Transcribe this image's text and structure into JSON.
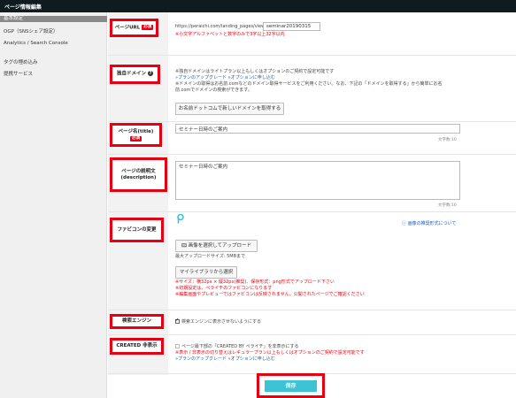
{
  "header": {
    "title": "ページ情報編集"
  },
  "sidebar": {
    "items": [
      {
        "label": "基本設定"
      },
      {
        "label": "OGP（SNSシェア設定）"
      },
      {
        "label": "Analytics / Search Console"
      },
      {
        "label": "タグの埋め込み"
      },
      {
        "label": "提携サービス"
      }
    ]
  },
  "rows": {
    "url": {
      "label": "ページURL",
      "required": "必須",
      "prefix": "https://peraichi.com/landing_pages/view/",
      "value": "seminar20190315",
      "note": "※小文字アルファベットと数字のみで3字以上32字以内"
    },
    "domain": {
      "label": "独自ドメイン",
      "help": "?",
      "note1": "※独自ドメインはライトプラン以上もしくはオプションのご契約で設定可能です",
      "link": "»プランのアップグレード »オプションに申し込む",
      "note2": "※ドメインの取得はお名前.comなどのドメイン取得サービスをご利用ください。なお、下記の「ドメインを取得する」から簡単にお名",
      "note3": "前.comでドメインの検索ができます。",
      "button": "お名前ドットコムで新しいドメインを取得する"
    },
    "title": {
      "label": "ページ名(title)",
      "required": "必須",
      "value": "セミナー日時のご案内",
      "counter": "文字数:10"
    },
    "description": {
      "label": "ページの説明文(description)",
      "value": "セミナー日時のご案内",
      "counter": "文字数:10"
    },
    "favicon": {
      "label": "ファビコンの変更",
      "help_link": "ⓘ 画像の推奨形式について",
      "upload_button": "画像を選択してアップロード",
      "max_size": "最大アップロードサイズ: 5MBまで",
      "library_button": "マイライブラリから選択",
      "note1": "※サイズ：横32px × 縦32px(推奨)、保存形式：png形式でアップロード下さい",
      "note2": "※初期設定は、ペライチのファビコンになります",
      "note3": "※編集画面やプレビューではファビコンは反映されません。公開されたページでご確認ください"
    },
    "search": {
      "label": "検索エンジン",
      "checkbox_label": "検索エンジンに表示させないようにする"
    },
    "created": {
      "label": "CREATED 非表示",
      "checkbox_label": "ページ最下部の「CREATED BY ペライチ」を非表示にする",
      "note": "※表示 / 非表示の切り替えはレギュラープラン以上もしくはオプションのご契約で設定可能です",
      "link": "»プランのアップグレード »オプションに申し込む"
    }
  },
  "save": {
    "label": "保存"
  },
  "colors": {
    "accent_red": "#e60012",
    "save_button": "#3cc4d6",
    "link_blue": "#1a5bb8",
    "topbar": "#0f1b1f"
  }
}
